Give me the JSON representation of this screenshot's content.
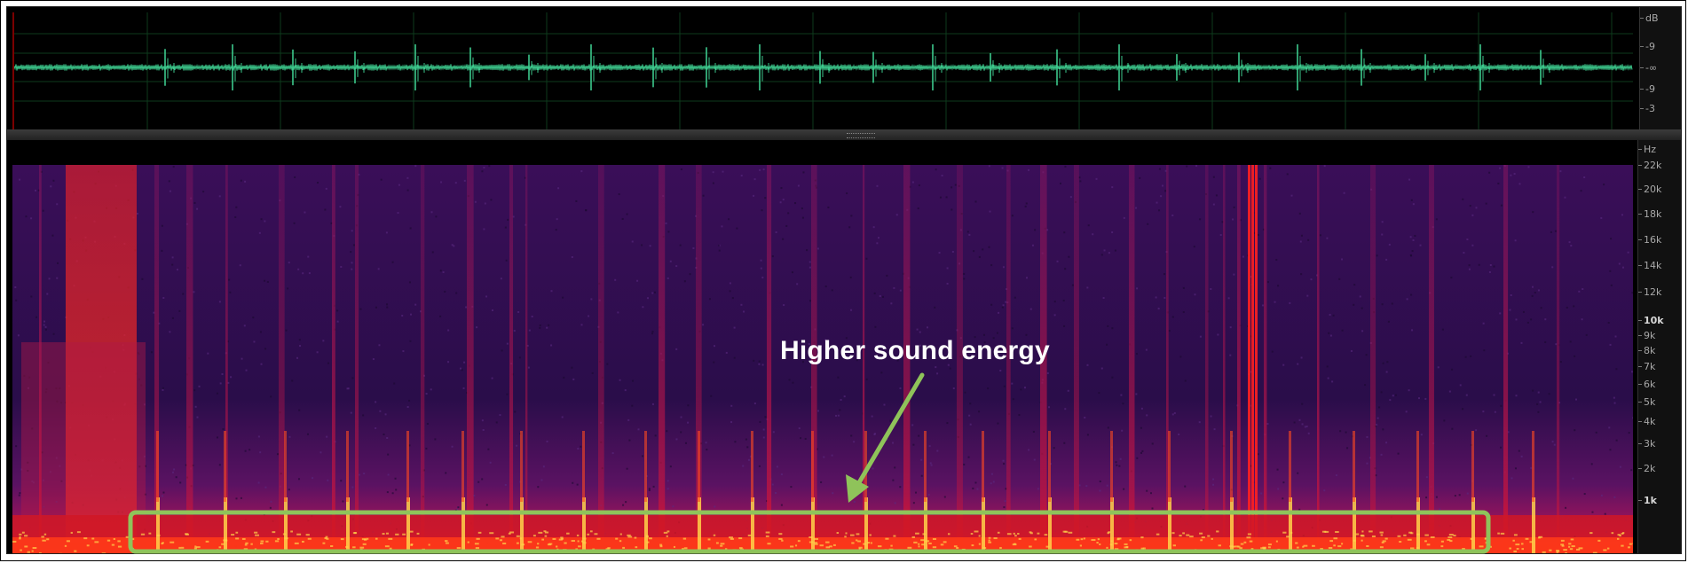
{
  "amplitude_ruler": {
    "unit": "dB",
    "ticks": [
      "-9",
      "-∞",
      "-9",
      "-3"
    ]
  },
  "frequency_ruler": {
    "unit": "Hz",
    "ticks": [
      {
        "label": "22k",
        "hz": 22000
      },
      {
        "label": "20k",
        "hz": 20000
      },
      {
        "label": "18k",
        "hz": 18000
      },
      {
        "label": "16k",
        "hz": 16000
      },
      {
        "label": "14k",
        "hz": 14000
      },
      {
        "label": "12k",
        "hz": 12000
      },
      {
        "label": "10k",
        "hz": 10000,
        "bold": true
      },
      {
        "label": "9k",
        "hz": 9000
      },
      {
        "label": "8k",
        "hz": 8000
      },
      {
        "label": "7k",
        "hz": 7000
      },
      {
        "label": "6k",
        "hz": 6000
      },
      {
        "label": "5k",
        "hz": 5000
      },
      {
        "label": "4k",
        "hz": 4000
      },
      {
        "label": "3k",
        "hz": 3000
      },
      {
        "label": "2k",
        "hz": 2000
      },
      {
        "label": "1k",
        "hz": 1000,
        "bold": true
      }
    ]
  },
  "annotation": {
    "label": "Higher sound energy",
    "highlight_color": "#8fc35a",
    "label_color": "#ffffff"
  },
  "colors": {
    "waveform": "#3cc88c",
    "spectrogram_low": "#2a0d4a",
    "spectrogram_mid": "#8a1560",
    "spectrogram_high": "#e8181e",
    "spectrogram_peak": "#ffd24a"
  }
}
